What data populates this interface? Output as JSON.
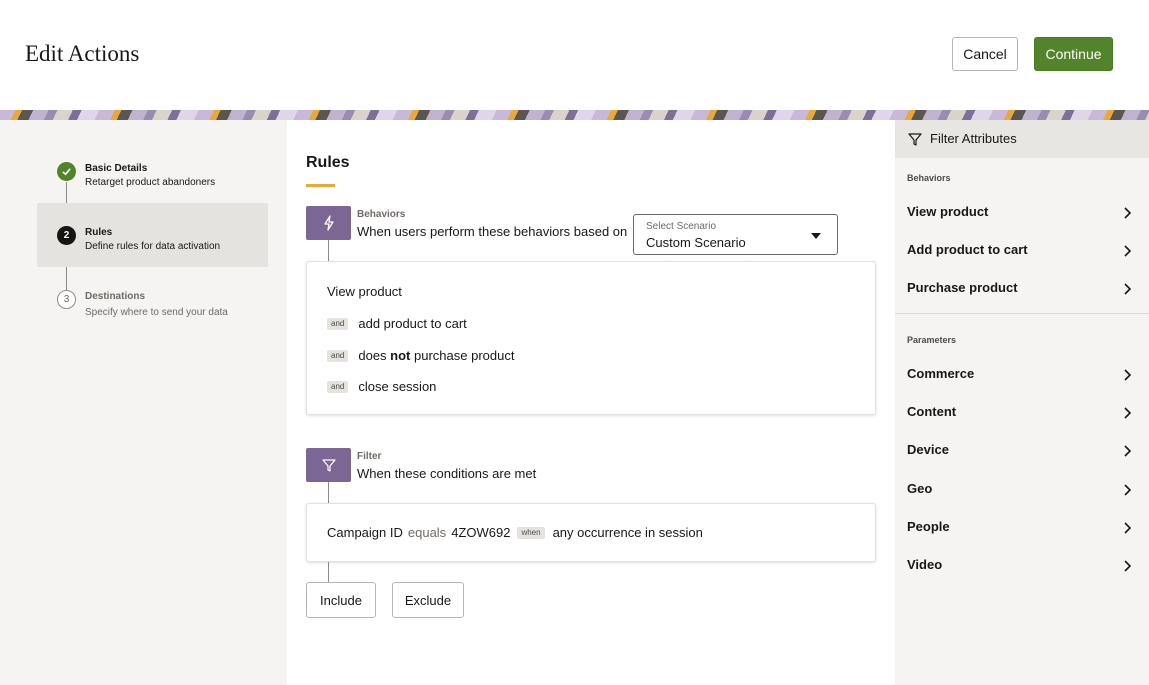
{
  "header": {
    "title": "Edit Actions",
    "cancel_label": "Cancel",
    "continue_label": "Continue",
    "continue_color": "#53832a"
  },
  "steps": [
    {
      "number": "",
      "title": "Basic Details",
      "subtitle": "Retarget product abandoners",
      "state": "done"
    },
    {
      "number": "2",
      "title": "Rules",
      "subtitle": "Define rules for data activation",
      "state": "current"
    },
    {
      "number": "3",
      "title": "Destinations",
      "subtitle": "Specify where to send your data",
      "state": "todo"
    }
  ],
  "main": {
    "title": "Rules",
    "accent_color": "#e8a83a",
    "badge_color": "#7b6694",
    "behaviors": {
      "label": "Behaviors",
      "text": "When users perform these behaviors based on",
      "icon": "lightning-icon",
      "scenario": {
        "label": "Select Scenario",
        "value": "Custom Scenario"
      },
      "first": "View product",
      "conditions": [
        {
          "tag": "and",
          "pre": "add product to cart",
          "bold": "",
          "post": ""
        },
        {
          "tag": "and",
          "pre": "does ",
          "bold": "not",
          "post": " purchase product"
        },
        {
          "tag": "and",
          "pre": "close session",
          "bold": "",
          "post": ""
        }
      ]
    },
    "filter": {
      "label": "Filter",
      "text": "When these conditions are met",
      "icon": "funnel-icon",
      "condition": {
        "attribute": "Campaign ID",
        "operator": "equals",
        "value": "4ZOW692",
        "tag": "when",
        "scope": "any occurrence in session"
      }
    },
    "include_label": "Include",
    "exclude_label": "Exclude"
  },
  "filter_panel": {
    "title": "Filter Attributes",
    "behaviors_label": "Behaviors",
    "behaviors": [
      "View product",
      "Add product to cart",
      "Purchase product"
    ],
    "parameters_label": "Parameters",
    "parameters": [
      "Commerce",
      "Content",
      "Device",
      "Geo",
      "People",
      "Video"
    ]
  }
}
